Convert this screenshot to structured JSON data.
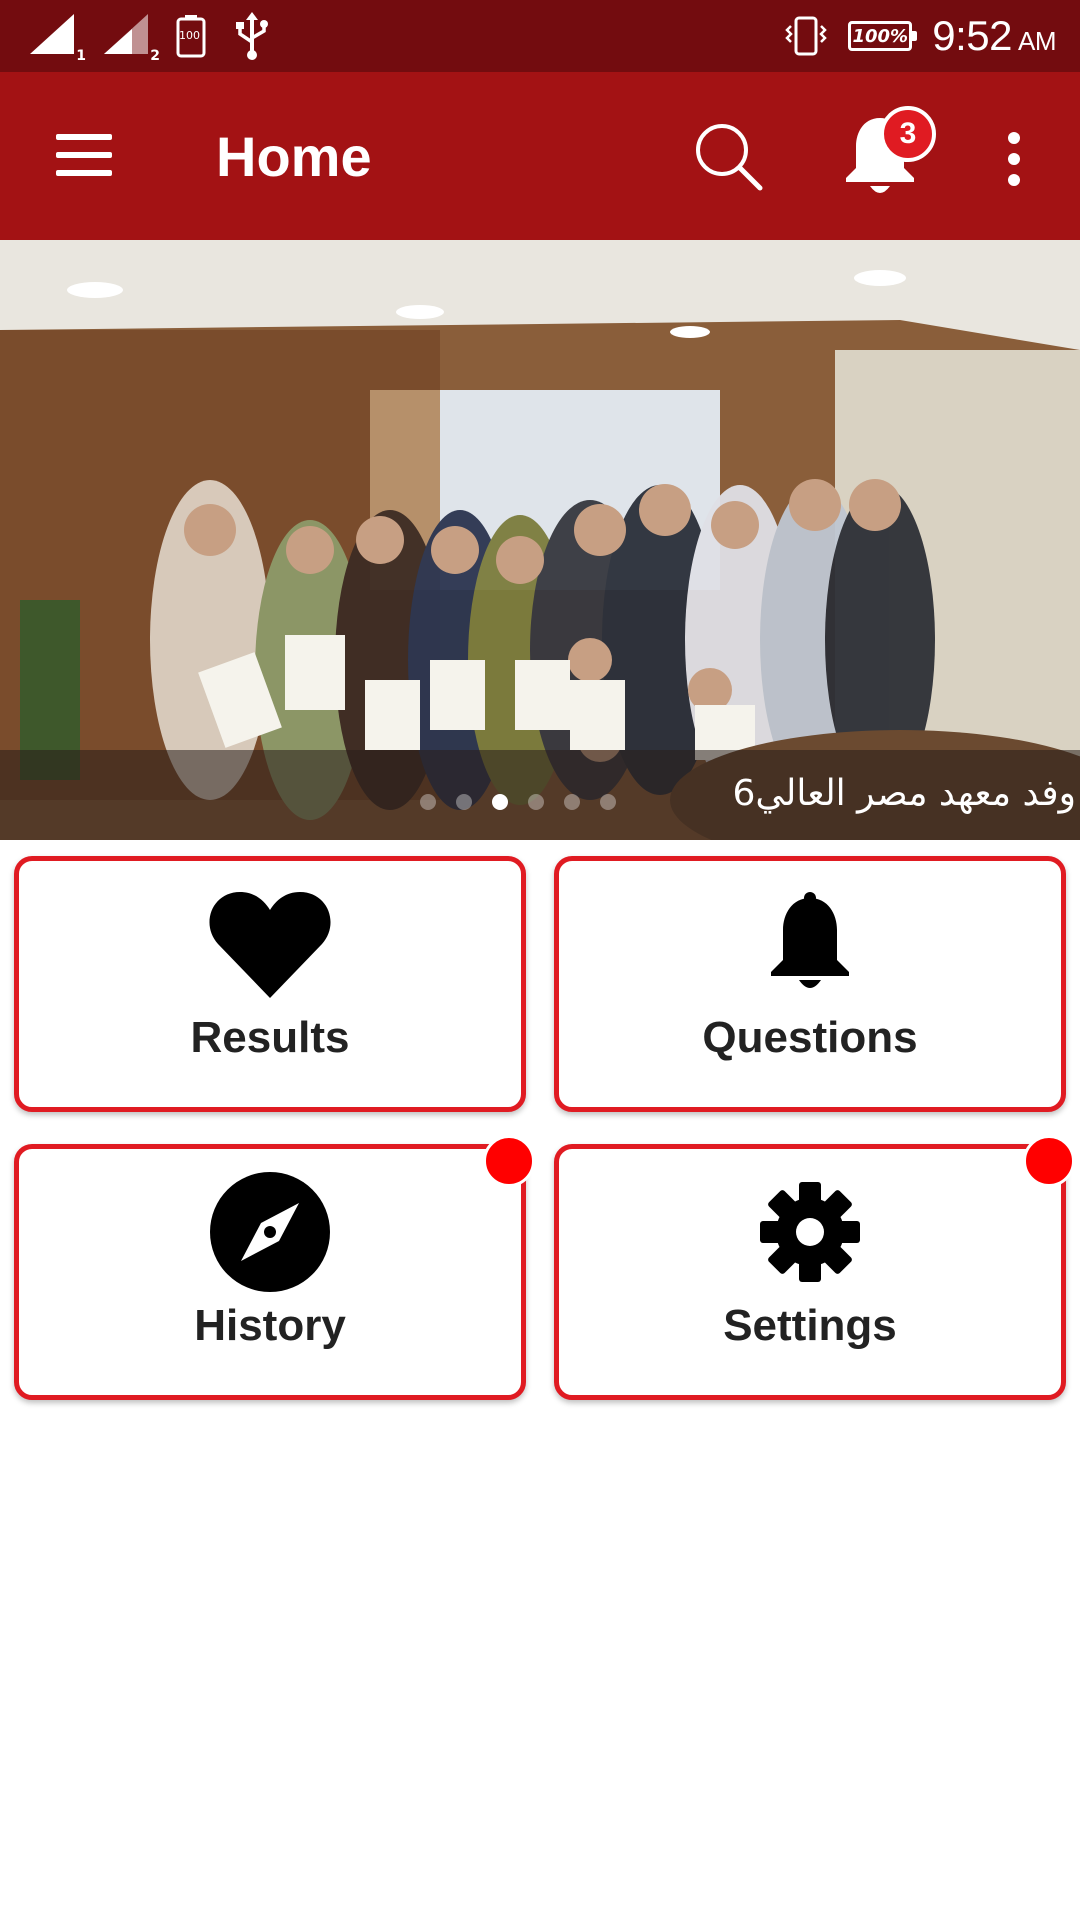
{
  "status_bar": {
    "sim1_label": "1",
    "sim2_label": "2",
    "battery_small_label": "100",
    "battery_percent": "100%",
    "time": "9:52",
    "ampm": "AM"
  },
  "app_bar": {
    "title": "Home",
    "notification_count": "3"
  },
  "banner": {
    "caption": "وفد معهد مصر العالي6",
    "slide_count": 6,
    "active_slide": 3
  },
  "cards": [
    {
      "label": "Results",
      "icon": "heart-icon",
      "has_dot": false
    },
    {
      "label": "Questions",
      "icon": "bell-icon",
      "has_dot": false
    },
    {
      "label": "History",
      "icon": "compass-icon",
      "has_dot": true
    },
    {
      "label": "Settings",
      "icon": "gear-icon",
      "has_dot": true
    }
  ],
  "colors": {
    "status_bar": "#730c0f",
    "app_bar": "#a31214",
    "accent_border": "#e01b22",
    "dot": "#ff0000"
  }
}
